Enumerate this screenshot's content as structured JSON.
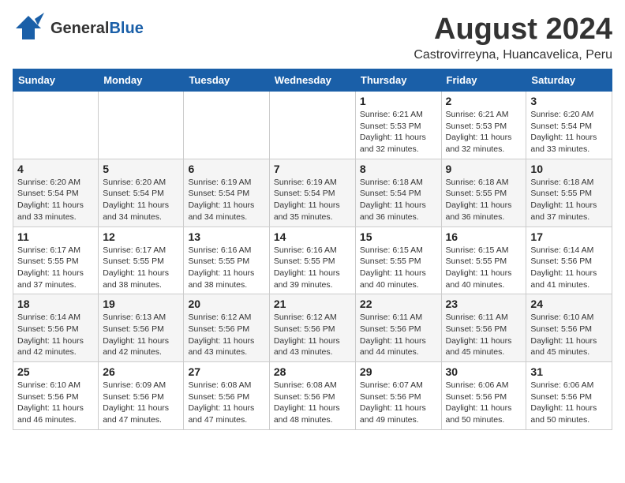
{
  "header": {
    "logo_general": "General",
    "logo_blue": "Blue",
    "month_year": "August 2024",
    "location": "Castrovirreyna, Huancavelica, Peru"
  },
  "weekdays": [
    "Sunday",
    "Monday",
    "Tuesday",
    "Wednesday",
    "Thursday",
    "Friday",
    "Saturday"
  ],
  "weeks": [
    [
      {
        "day": "",
        "info": ""
      },
      {
        "day": "",
        "info": ""
      },
      {
        "day": "",
        "info": ""
      },
      {
        "day": "",
        "info": ""
      },
      {
        "day": "1",
        "info": "Sunrise: 6:21 AM\nSunset: 5:53 PM\nDaylight: 11 hours\nand 32 minutes."
      },
      {
        "day": "2",
        "info": "Sunrise: 6:21 AM\nSunset: 5:53 PM\nDaylight: 11 hours\nand 32 minutes."
      },
      {
        "day": "3",
        "info": "Sunrise: 6:20 AM\nSunset: 5:54 PM\nDaylight: 11 hours\nand 33 minutes."
      }
    ],
    [
      {
        "day": "4",
        "info": "Sunrise: 6:20 AM\nSunset: 5:54 PM\nDaylight: 11 hours\nand 33 minutes."
      },
      {
        "day": "5",
        "info": "Sunrise: 6:20 AM\nSunset: 5:54 PM\nDaylight: 11 hours\nand 34 minutes."
      },
      {
        "day": "6",
        "info": "Sunrise: 6:19 AM\nSunset: 5:54 PM\nDaylight: 11 hours\nand 34 minutes."
      },
      {
        "day": "7",
        "info": "Sunrise: 6:19 AM\nSunset: 5:54 PM\nDaylight: 11 hours\nand 35 minutes."
      },
      {
        "day": "8",
        "info": "Sunrise: 6:18 AM\nSunset: 5:54 PM\nDaylight: 11 hours\nand 36 minutes."
      },
      {
        "day": "9",
        "info": "Sunrise: 6:18 AM\nSunset: 5:55 PM\nDaylight: 11 hours\nand 36 minutes."
      },
      {
        "day": "10",
        "info": "Sunrise: 6:18 AM\nSunset: 5:55 PM\nDaylight: 11 hours\nand 37 minutes."
      }
    ],
    [
      {
        "day": "11",
        "info": "Sunrise: 6:17 AM\nSunset: 5:55 PM\nDaylight: 11 hours\nand 37 minutes."
      },
      {
        "day": "12",
        "info": "Sunrise: 6:17 AM\nSunset: 5:55 PM\nDaylight: 11 hours\nand 38 minutes."
      },
      {
        "day": "13",
        "info": "Sunrise: 6:16 AM\nSunset: 5:55 PM\nDaylight: 11 hours\nand 38 minutes."
      },
      {
        "day": "14",
        "info": "Sunrise: 6:16 AM\nSunset: 5:55 PM\nDaylight: 11 hours\nand 39 minutes."
      },
      {
        "day": "15",
        "info": "Sunrise: 6:15 AM\nSunset: 5:55 PM\nDaylight: 11 hours\nand 40 minutes."
      },
      {
        "day": "16",
        "info": "Sunrise: 6:15 AM\nSunset: 5:55 PM\nDaylight: 11 hours\nand 40 minutes."
      },
      {
        "day": "17",
        "info": "Sunrise: 6:14 AM\nSunset: 5:56 PM\nDaylight: 11 hours\nand 41 minutes."
      }
    ],
    [
      {
        "day": "18",
        "info": "Sunrise: 6:14 AM\nSunset: 5:56 PM\nDaylight: 11 hours\nand 42 minutes."
      },
      {
        "day": "19",
        "info": "Sunrise: 6:13 AM\nSunset: 5:56 PM\nDaylight: 11 hours\nand 42 minutes."
      },
      {
        "day": "20",
        "info": "Sunrise: 6:12 AM\nSunset: 5:56 PM\nDaylight: 11 hours\nand 43 minutes."
      },
      {
        "day": "21",
        "info": "Sunrise: 6:12 AM\nSunset: 5:56 PM\nDaylight: 11 hours\nand 43 minutes."
      },
      {
        "day": "22",
        "info": "Sunrise: 6:11 AM\nSunset: 5:56 PM\nDaylight: 11 hours\nand 44 minutes."
      },
      {
        "day": "23",
        "info": "Sunrise: 6:11 AM\nSunset: 5:56 PM\nDaylight: 11 hours\nand 45 minutes."
      },
      {
        "day": "24",
        "info": "Sunrise: 6:10 AM\nSunset: 5:56 PM\nDaylight: 11 hours\nand 45 minutes."
      }
    ],
    [
      {
        "day": "25",
        "info": "Sunrise: 6:10 AM\nSunset: 5:56 PM\nDaylight: 11 hours\nand 46 minutes."
      },
      {
        "day": "26",
        "info": "Sunrise: 6:09 AM\nSunset: 5:56 PM\nDaylight: 11 hours\nand 47 minutes."
      },
      {
        "day": "27",
        "info": "Sunrise: 6:08 AM\nSunset: 5:56 PM\nDaylight: 11 hours\nand 47 minutes."
      },
      {
        "day": "28",
        "info": "Sunrise: 6:08 AM\nSunset: 5:56 PM\nDaylight: 11 hours\nand 48 minutes."
      },
      {
        "day": "29",
        "info": "Sunrise: 6:07 AM\nSunset: 5:56 PM\nDaylight: 11 hours\nand 49 minutes."
      },
      {
        "day": "30",
        "info": "Sunrise: 6:06 AM\nSunset: 5:56 PM\nDaylight: 11 hours\nand 50 minutes."
      },
      {
        "day": "31",
        "info": "Sunrise: 6:06 AM\nSunset: 5:56 PM\nDaylight: 11 hours\nand 50 minutes."
      }
    ]
  ]
}
